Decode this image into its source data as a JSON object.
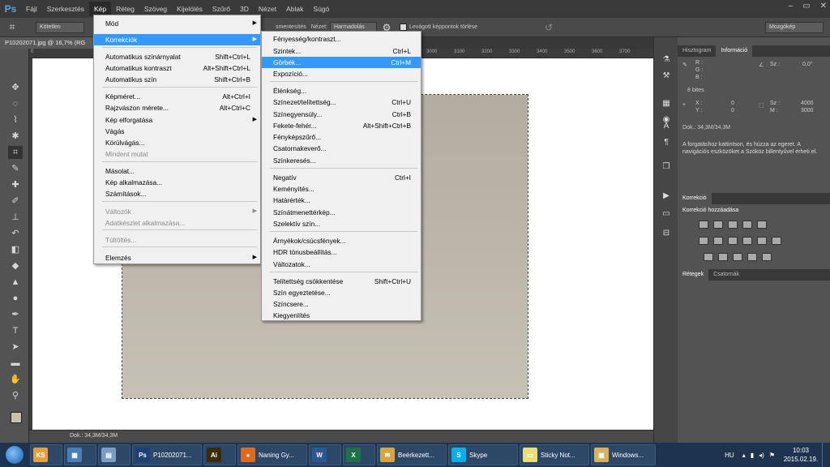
{
  "menubar": {
    "logo": "Ps",
    "items": [
      "Fájl",
      "Szerkesztés",
      "Kép",
      "Réteg",
      "Szöveg",
      "Kijelölés",
      "Szűrő",
      "3D",
      "Nézet",
      "Ablak",
      "Súgó"
    ],
    "active": "Kép"
  },
  "optbar": {
    "left_field": "Kötetlen",
    "straighten": "smentesítés",
    "view_label": "Nézet:",
    "view_value": "Harmadolás",
    "delete_pixels": "Levágott képpontok törlése",
    "workspace": "Mozgókép"
  },
  "doc": {
    "tab_title": "P10202071.jpg @ 16,7% (RG",
    "ruler_ticks": [
      "0",
      "3000",
      "3100",
      "3200",
      "3300",
      "3400",
      "3500",
      "3600",
      "3700",
      "3800",
      "3900",
      "4000",
      "4100"
    ],
    "status": "Dok.: 34,3M/34,3M"
  },
  "kep_menu": [
    {
      "label": "Mód",
      "shortcut": "",
      "sub": true,
      "disabled": false
    },
    {
      "label": "Korrekciók",
      "shortcut": "",
      "sub": true,
      "disabled": false,
      "highlight": true
    },
    {
      "label": "Automatikus színárnyalat",
      "shortcut": "Shift+Ctrl+L",
      "sub": false,
      "disabled": false
    },
    {
      "label": "Automatikus kontraszt",
      "shortcut": "Alt+Shift+Ctrl+L",
      "sub": false,
      "disabled": false
    },
    {
      "label": "Automatikus szín",
      "shortcut": "Shift+Ctrl+B",
      "sub": false,
      "disabled": false
    },
    {
      "label": "Képméret...",
      "shortcut": "Alt+Ctrl+I",
      "sub": false,
      "disabled": false
    },
    {
      "label": "Rajzvászon mérete...",
      "shortcut": "Alt+Ctrl+C",
      "sub": false,
      "disabled": false
    },
    {
      "label": "Kép elforgatása",
      "shortcut": "",
      "sub": true,
      "disabled": false
    },
    {
      "label": "Vágás",
      "shortcut": "",
      "sub": false,
      "disabled": false
    },
    {
      "label": "Körülvágás...",
      "shortcut": "",
      "sub": false,
      "disabled": false
    },
    {
      "label": "Mindent mutat",
      "shortcut": "",
      "sub": false,
      "disabled": true
    },
    {
      "label": "Másolat...",
      "shortcut": "",
      "sub": false,
      "disabled": false
    },
    {
      "label": "Kép alkalmazása...",
      "shortcut": "",
      "sub": false,
      "disabled": false
    },
    {
      "label": "Számítások...",
      "shortcut": "",
      "sub": false,
      "disabled": false
    },
    {
      "label": "Változók",
      "shortcut": "",
      "sub": true,
      "disabled": true
    },
    {
      "label": "Adatkészlet alkalmazása...",
      "shortcut": "",
      "sub": false,
      "disabled": true
    },
    {
      "label": "Túltöltés...",
      "shortcut": "",
      "sub": false,
      "disabled": true
    },
    {
      "label": "Elemzés",
      "shortcut": "",
      "sub": true,
      "disabled": false
    }
  ],
  "korr_menu": [
    {
      "label": "Fényesség/kontraszt...",
      "shortcut": ""
    },
    {
      "label": "Szintek...",
      "shortcut": "Ctrl+L"
    },
    {
      "label": "Görbék...",
      "shortcut": "Ctrl+M",
      "highlight": true
    },
    {
      "label": "Expozíció...",
      "shortcut": ""
    },
    {
      "label": "Élénkség...",
      "shortcut": ""
    },
    {
      "label": "Színezet/telítettség...",
      "shortcut": "Ctrl+U"
    },
    {
      "label": "Színegyensúly...",
      "shortcut": "Ctrl+B"
    },
    {
      "label": "Fekete-fehér...",
      "shortcut": "Alt+Shift+Ctrl+B"
    },
    {
      "label": "Fényképszűrő...",
      "shortcut": ""
    },
    {
      "label": "Csatornakeverő...",
      "shortcut": ""
    },
    {
      "label": "Színkeresés...",
      "shortcut": ""
    },
    {
      "label": "Negatív",
      "shortcut": "Ctrl+I"
    },
    {
      "label": "Keményítés...",
      "shortcut": ""
    },
    {
      "label": "Határérték...",
      "shortcut": ""
    },
    {
      "label": "Színátmenettérkép...",
      "shortcut": ""
    },
    {
      "label": "Szelektív szín...",
      "shortcut": ""
    },
    {
      "label": "Árnyékok/csúcsfények...",
      "shortcut": ""
    },
    {
      "label": "HDR tónusbeállítás...",
      "shortcut": ""
    },
    {
      "label": "Változatok...",
      "shortcut": ""
    },
    {
      "label": "Telítettség csökkentése",
      "shortcut": "Shift+Ctrl+U"
    },
    {
      "label": "Szín egyeztetése...",
      "shortcut": ""
    },
    {
      "label": "Színcsere...",
      "shortcut": ""
    },
    {
      "label": "Kiegyenlítés",
      "shortcut": ""
    }
  ],
  "panels": {
    "top_tabs": [
      "Hisztogram",
      "Információ"
    ],
    "info_r": "R :",
    "info_g": "G :",
    "info_b": "B :",
    "info_sz": "Sz :",
    "info_angle": "0,0°",
    "bits": "8 bites",
    "x_label": "X :",
    "x_val": "0",
    "y_label": "Y :",
    "y_val": "0",
    "w_label": "Sz :",
    "w_val": "4000",
    "h_label": "M :",
    "h_val": "3000",
    "dok": "Dok.: 34,3M/34,3M",
    "hint": "A forgatáshoz kattintson, és húzza az egeret. A navigációs eszközöket a Szóköz billentyűvel érheti el.",
    "adj_tab": "Korrekció",
    "adj_title": "Korrekció hozzáadása",
    "layer_tabs": [
      "Rétegek",
      "Csatornák"
    ]
  },
  "taskbar": {
    "items": [
      {
        "label": "",
        "icon": "KS",
        "color": "#e8a13a"
      },
      {
        "label": "",
        "icon": "▦",
        "color": "#4a7fb5"
      },
      {
        "label": "",
        "icon": "▤",
        "color": "#7a9cc6"
      },
      {
        "label": "P10202071...",
        "icon": "Ps",
        "color": "#1c3f7a"
      },
      {
        "label": "",
        "icon": "Ai",
        "color": "#3a2a05"
      },
      {
        "label": "Naning Gy...",
        "icon": "●",
        "color": "#e06a1c"
      },
      {
        "label": "",
        "icon": "W",
        "color": "#2b5797"
      },
      {
        "label": "",
        "icon": "X",
        "color": "#1e7145"
      },
      {
        "label": "Beérkezett...",
        "icon": "✉",
        "color": "#d9a43b"
      },
      {
        "label": "Skype",
        "icon": "S",
        "color": "#00aff0"
      },
      {
        "label": "Sticky Not...",
        "icon": "▭",
        "color": "#e8e070"
      },
      {
        "label": "Windows...",
        "icon": "▣",
        "color": "#d9b25a"
      }
    ],
    "lang": "HU",
    "time": "10:03",
    "date": "2015.02.19."
  }
}
